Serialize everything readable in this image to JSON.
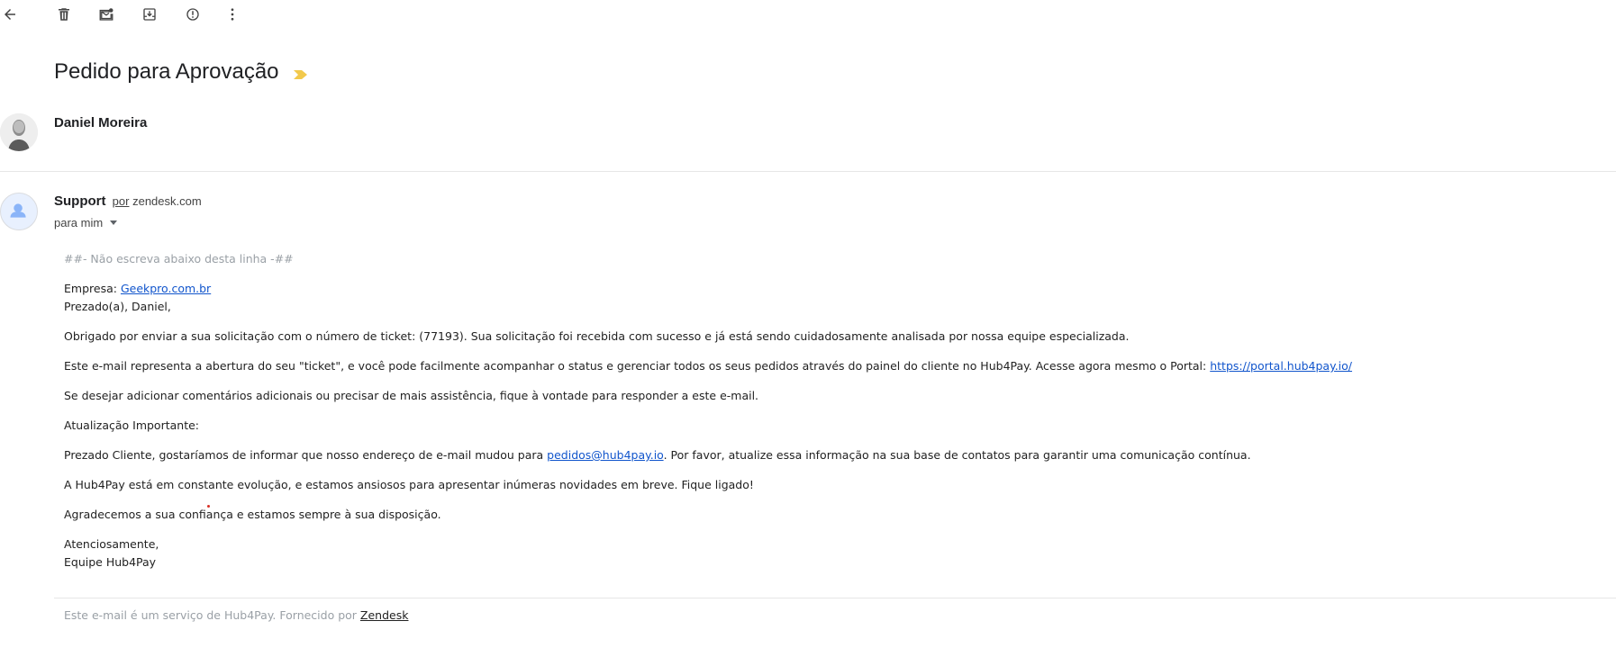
{
  "toolbar": {
    "icons": [
      "back-arrow-icon",
      "delete-icon",
      "mark-unread-icon",
      "move-to-icon",
      "report-spam-icon",
      "more-options-icon"
    ]
  },
  "subject": "Pedido para Aprovação",
  "importance_color": "#f2c94c",
  "thread_sender": "Daniel Moreira",
  "message": {
    "from_name": "Support",
    "via_label": "por",
    "via_domain": "zendesk.com",
    "to_label": "para mim",
    "body": {
      "marker": "##- Não escreva abaixo desta linha -##",
      "company_label": "Empresa:",
      "company_link": "Geekpro.com.br",
      "greeting": "Prezado(a), Daniel,",
      "p1": "Obrigado por enviar a sua solicitação com o número de ticket: (77193). Sua solicitação foi recebida com sucesso e já está sendo cuidadosamente analisada por nossa equipe especializada.",
      "p2_text": "Este e-mail representa a abertura do seu \"ticket\", e você pode facilmente acompanhar o status e gerenciar todos os seus pedidos através do painel do cliente no Hub4Pay. Acesse agora mesmo o Portal:",
      "p2_link": "https://portal.hub4pay.io/",
      "p3": "Se desejar adicionar comentários adicionais ou precisar de mais assistência, fique à vontade para responder a este e-mail.",
      "p4": "Atualização Importante:",
      "p5_pre": "Prezado Cliente, gostaríamos de informar que nosso endereço de e-mail mudou para",
      "p5_link": "pedidos@hub4pay.io",
      "p5_post": ". Por favor, atualize essa informação na sua base de contatos para garantir uma comunicação contínua.",
      "p6": "A Hub4Pay está em constante evolução, e estamos ansiosos para apresentar inúmeras novidades em breve. Fique ligado!",
      "p7": "Agradecemos a sua confiança e estamos sempre à sua disposição.",
      "signoff": "Atenciosamente,",
      "team": "Equipe Hub4Pay"
    },
    "footer_text": "Este e-mail é um serviço de Hub4Pay. Fornecido por",
    "footer_link": "Zendesk"
  },
  "colors": {
    "link": "#1155cc",
    "muted": "#9aa0a6"
  }
}
